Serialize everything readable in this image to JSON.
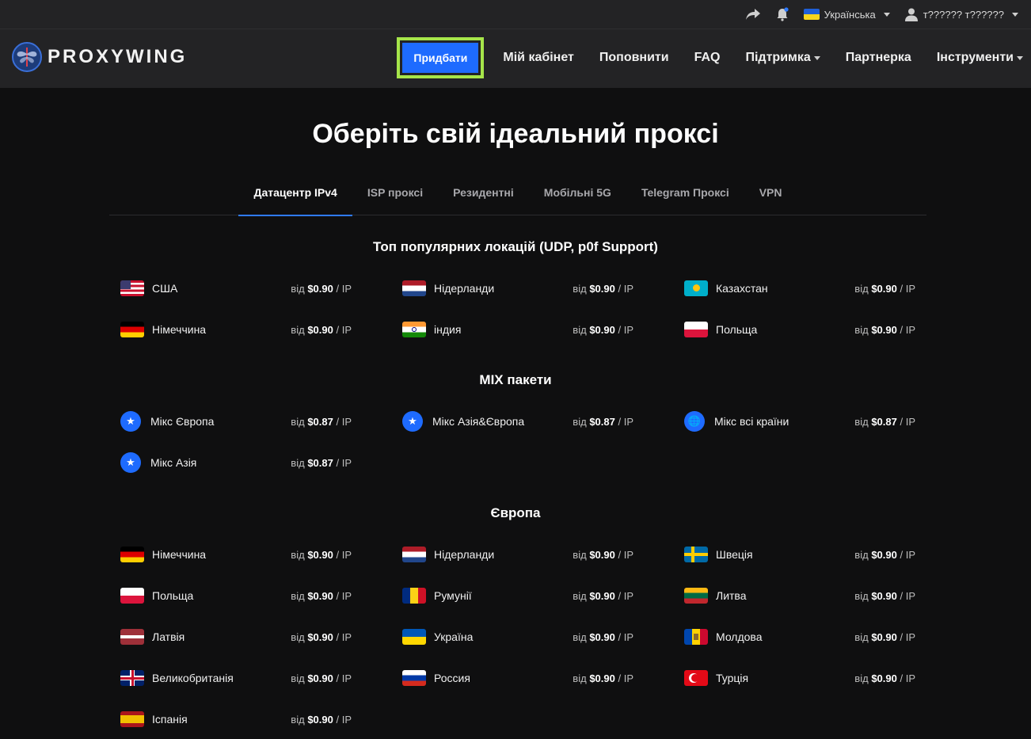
{
  "topbar": {
    "language": "Українська",
    "user": "т?????? т??????"
  },
  "brand": {
    "name": "PROXYWING"
  },
  "nav": {
    "buy": "Придбати",
    "items": [
      "Мій кабінет",
      "Поповнити",
      "FAQ",
      "Підтримка",
      "Партнерка",
      "Інструменти"
    ]
  },
  "hero": {
    "title": "Оберіть свій ідеальний проксі"
  },
  "tabs": [
    "Датацентр IPv4",
    "ISP проксі",
    "Резидентні",
    "Мобільні 5G",
    "Telegram Проксі",
    "VPN"
  ],
  "price_prefix": "від",
  "price_suffix": "/ IP",
  "sections": [
    {
      "title": "Топ популярних локацій (UDP, p0f Support)",
      "rows": [
        [
          {
            "name": "США",
            "price": "$0.90",
            "flag": "us"
          },
          {
            "name": "Нідерланди",
            "price": "$0.90",
            "flag": "nl"
          },
          {
            "name": "Казахстан",
            "price": "$0.90",
            "flag": "kz"
          }
        ],
        [
          {
            "name": "Німеччина",
            "price": "$0.90",
            "flag": "de"
          },
          {
            "name": "індия",
            "price": "$0.90",
            "flag": "in"
          },
          {
            "name": "Польща",
            "price": "$0.90",
            "flag": "pl"
          }
        ]
      ]
    },
    {
      "title": "MIX пакети",
      "rows": [
        [
          {
            "name": "Мікс Європа",
            "price": "$0.87",
            "flag": "mix"
          },
          {
            "name": "Мікс Азія&Європа",
            "price": "$0.87",
            "flag": "mix"
          },
          {
            "name": "Мікс всі країни",
            "price": "$0.87",
            "flag": "globe"
          }
        ],
        [
          {
            "name": "Мікс Азія",
            "price": "$0.87",
            "flag": "mix"
          }
        ]
      ]
    },
    {
      "title": "Європа",
      "rows": [
        [
          {
            "name": "Німеччина",
            "price": "$0.90",
            "flag": "de"
          },
          {
            "name": "Нідерланди",
            "price": "$0.90",
            "flag": "nl"
          },
          {
            "name": "Швеція",
            "price": "$0.90",
            "flag": "se"
          }
        ],
        [
          {
            "name": "Польща",
            "price": "$0.90",
            "flag": "pl"
          },
          {
            "name": "Румунії",
            "price": "$0.90",
            "flag": "ro"
          },
          {
            "name": "Литва",
            "price": "$0.90",
            "flag": "lt"
          }
        ],
        [
          {
            "name": "Латвія",
            "price": "$0.90",
            "flag": "lv"
          },
          {
            "name": "Україна",
            "price": "$0.90",
            "flag": "ua"
          },
          {
            "name": "Молдова",
            "price": "$0.90",
            "flag": "md"
          }
        ],
        [
          {
            "name": "Великобританія",
            "price": "$0.90",
            "flag": "gb"
          },
          {
            "name": "Россия",
            "price": "$0.90",
            "flag": "ru"
          },
          {
            "name": "Турція",
            "price": "$0.90",
            "flag": "tr"
          }
        ],
        [
          {
            "name": "Іспанія",
            "price": "$0.90",
            "flag": "es"
          }
        ]
      ]
    }
  ]
}
